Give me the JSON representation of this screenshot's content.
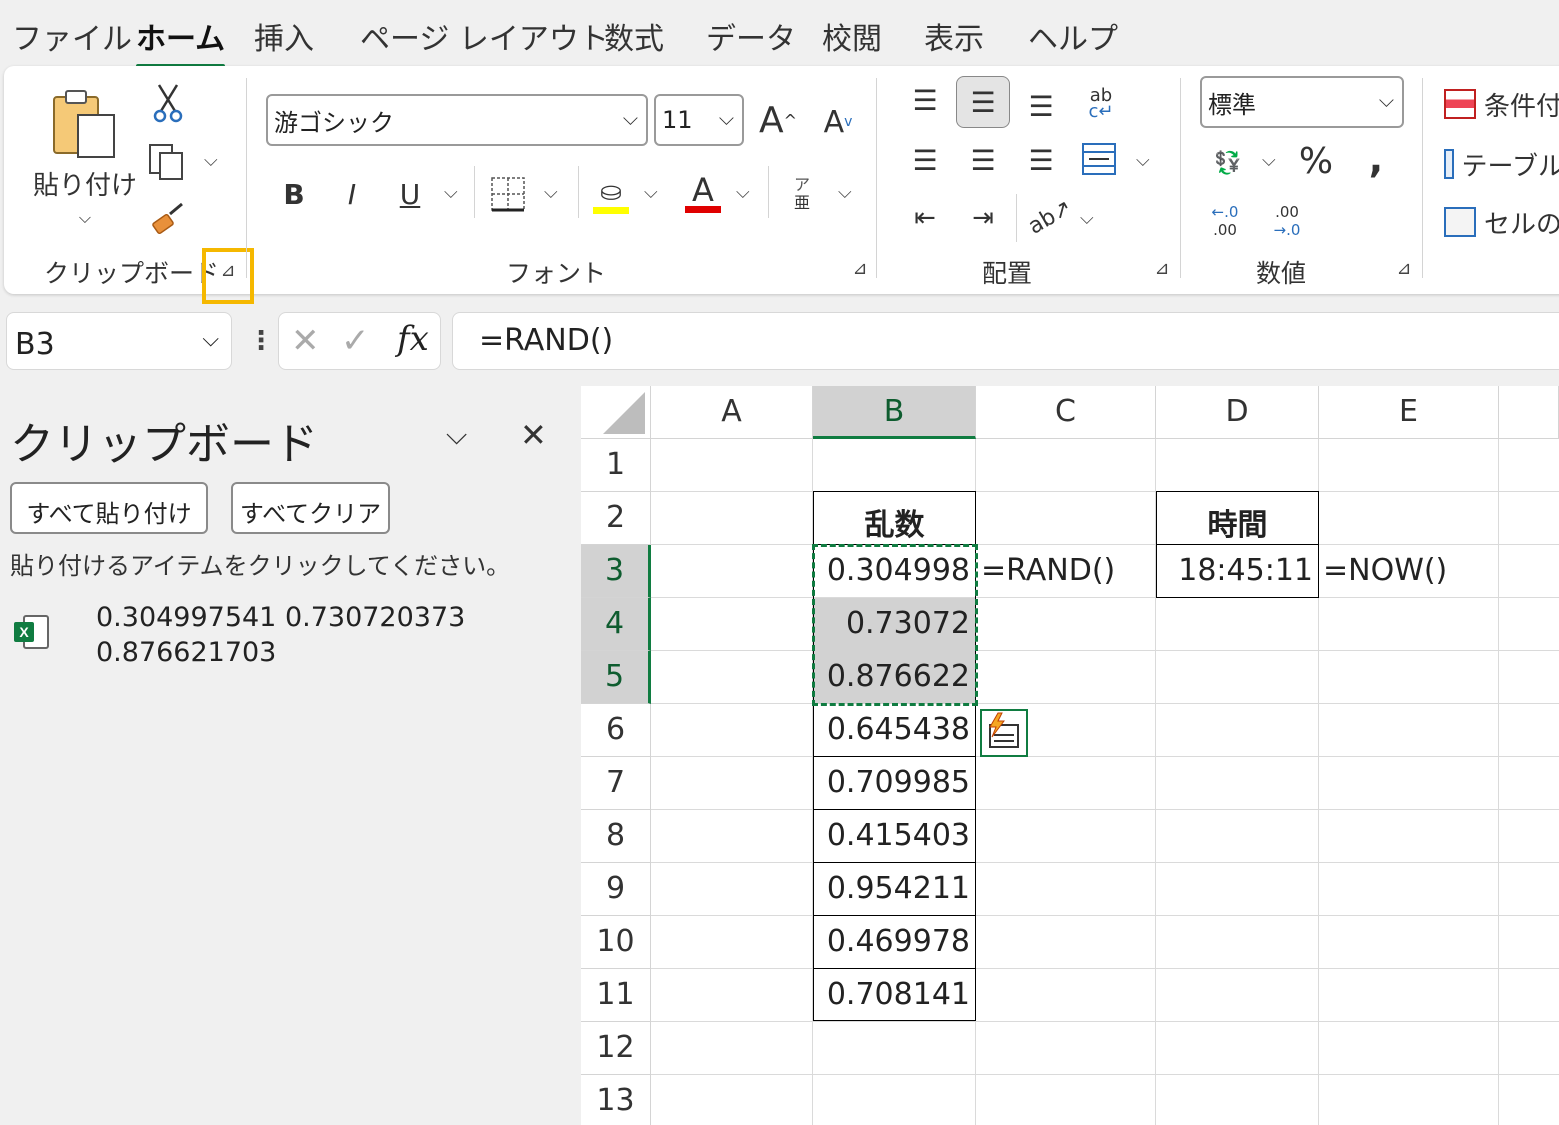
{
  "menu": {
    "tabs": [
      "ファイル",
      "ホーム",
      "挿入",
      "ページ レイアウト",
      "数式",
      "データ",
      "校閲",
      "表示",
      "ヘルプ"
    ],
    "active_tab": "ホーム"
  },
  "ribbon": {
    "clipboard": {
      "paste_label": "貼り付け",
      "group_label": "クリップボード"
    },
    "font": {
      "font_name": "游ゴシック",
      "font_size": "11",
      "group_label": "フォント",
      "highlight_color": "#ffff00",
      "font_color": "#ff0000"
    },
    "alignment": {
      "group_label": "配置"
    },
    "number": {
      "format": "標準",
      "group_label": "数値"
    },
    "styles": {
      "conditional_label": "条件付",
      "table_label": "テーブル",
      "cell_label": "セルの"
    }
  },
  "formula_bar": {
    "name_box": "B3",
    "formula": "=RAND()"
  },
  "clipboard_pane": {
    "title": "クリップボード",
    "paste_all": "すべて貼り付け",
    "clear_all": "すべてクリア",
    "hint": "貼り付けるアイテムをクリックしてください。",
    "items": [
      {
        "line1": "0.304997541 0.730720373",
        "line2": "0.876621703"
      }
    ]
  },
  "sheet": {
    "columns": [
      "A",
      "B",
      "C",
      "D",
      "E"
    ],
    "selected_column": "B",
    "rows": [
      "1",
      "2",
      "3",
      "4",
      "5",
      "6",
      "7",
      "8",
      "9",
      "10",
      "11",
      "12",
      "13"
    ],
    "selected_rows": [
      "3",
      "4",
      "5"
    ],
    "header_b": "乱数",
    "header_d": "時間",
    "b_values": [
      "0.304998",
      "0.73072",
      "0.876622",
      "0.645438",
      "0.709985",
      "0.415403",
      "0.954211",
      "0.469978",
      "0.708141"
    ],
    "c3": "=RAND()",
    "d3": "18:45:11",
    "e3": "=NOW()"
  },
  "colors": {
    "accent": "#107c41",
    "highlight_box": "#f5b800",
    "selection_fill": "#d2d2d2"
  }
}
